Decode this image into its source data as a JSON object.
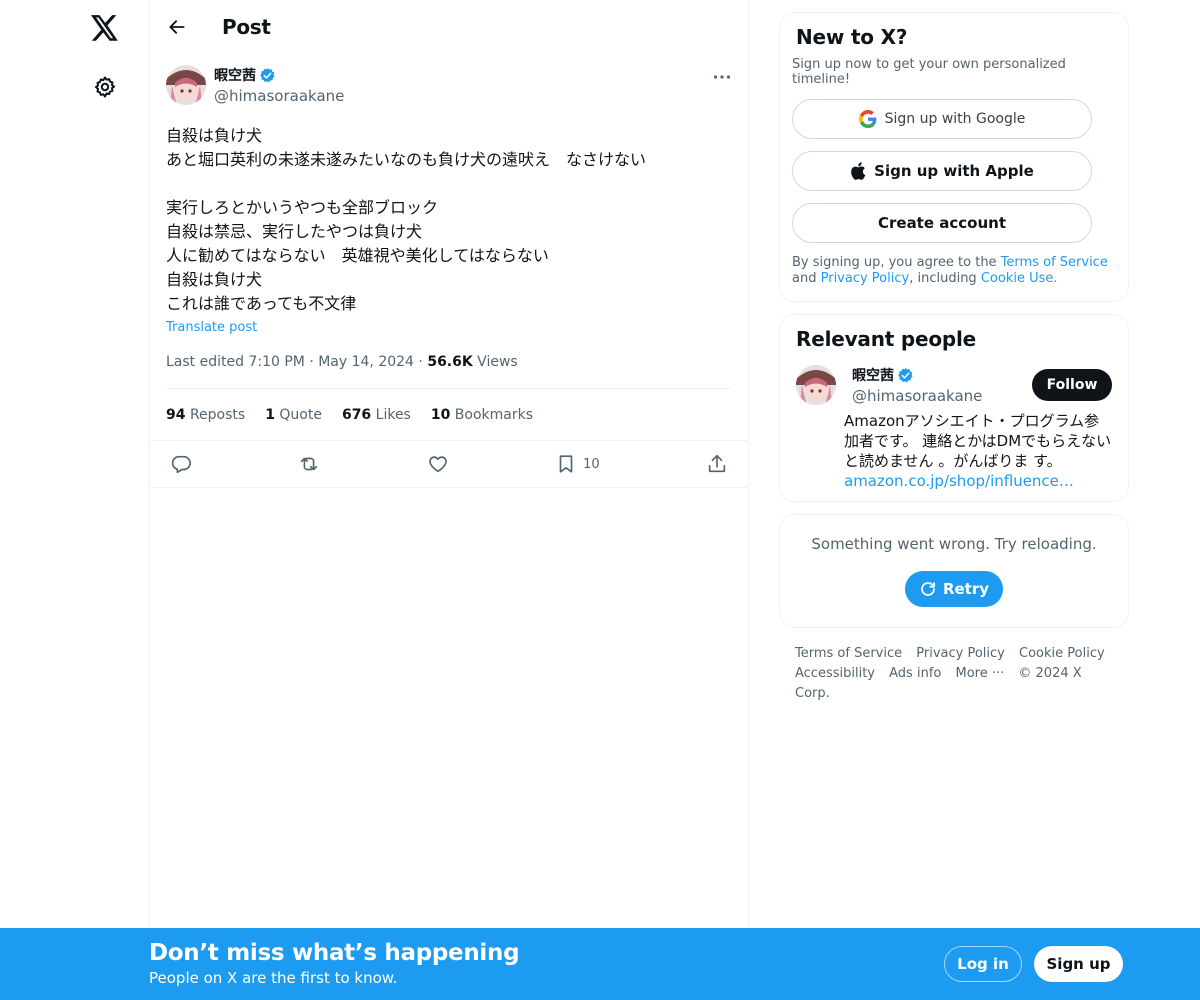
{
  "header": {
    "title": "Post"
  },
  "post": {
    "author_name": "暇空茜",
    "author_handle": "@himasoraakane",
    "text": "自殺は負け犬\nあと堀口英利の未遂未遂みたいなのも負け犬の遠吠え　なさけない\n\n実行しろとかいうやつも全部ブロック\n自殺は禁忌、実行したやつは負け犬\n人に勧めてはならない　英雄視や美化してはならない\n自殺は負け犬\nこれは誰であっても不文律",
    "translate_label": "Translate post",
    "edited_label": "Last edited 7:10 PM",
    "date": "May 14, 2024",
    "views_count": "56.6K",
    "views_label": "Views",
    "stats": {
      "reposts_count": "94",
      "reposts_label": "Reposts",
      "quote_count": "1",
      "quote_label": "Quote",
      "likes_count": "676",
      "likes_label": "Likes",
      "bookmarks_count": "10",
      "bookmarks_label": "Bookmarks"
    },
    "actions": {
      "bookmark_count": "10"
    }
  },
  "signup_card": {
    "title": "New to X?",
    "subtitle": "Sign up now to get your own personalized timeline!",
    "google_label": "Sign up with Google",
    "apple_label": "Sign up with Apple",
    "create_label": "Create account",
    "legal_prefix": "By signing up, you agree to the",
    "terms_link": "Terms of Service",
    "and_text": "and",
    "privacy_link": "Privacy Policy",
    "including_text": ", including",
    "cookie_link": "Cookie Use."
  },
  "relevant": {
    "title": "Relevant people",
    "name": "暇空茜",
    "handle": "@himasoraakane",
    "follow_label": "Follow",
    "bio": "Amazonアソシエイト・プログラム参加者です。 連絡とかはDMでもらえないと読めません 。がんばりま す。",
    "bio_link": "amazon.co.jp/shop/influence…"
  },
  "error_card": {
    "message": "Something went wrong. Try reloading.",
    "retry_label": "Retry"
  },
  "footer": {
    "terms": "Terms of Service",
    "privacy": "Privacy Policy",
    "cookie": "Cookie Policy",
    "accessibility": "Accessibility",
    "ads": "Ads info",
    "more": "More ···",
    "copyright": "© 2024 X Corp."
  },
  "bottom_bar": {
    "title": "Don’t miss what’s happening",
    "subtitle": "People on X are the first to know.",
    "login_label": "Log in",
    "signup_label": "Sign up"
  },
  "colors": {
    "accent": "#1d9bf0",
    "text": "#0f1419",
    "muted": "#536471"
  }
}
